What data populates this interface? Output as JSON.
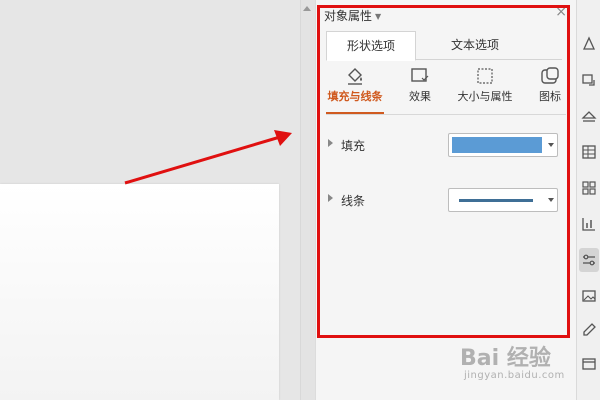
{
  "panel": {
    "title": "对象属性",
    "close_symbol": "×",
    "tabs": [
      {
        "label": "形状选项",
        "active": true
      },
      {
        "label": "文本选项",
        "active": false
      }
    ],
    "subtabs": [
      {
        "label": "填充与线条",
        "icon": "fill-bucket-icon",
        "active": true
      },
      {
        "label": "效果",
        "icon": "effects-icon",
        "active": false
      },
      {
        "label": "大小与属性",
        "icon": "size-properties-icon",
        "active": false
      },
      {
        "label": "图标",
        "icon": "picture-icon",
        "active": false
      }
    ],
    "sections": [
      {
        "label": "填充",
        "value_color": "#5b9bd5"
      },
      {
        "label": "线条",
        "value_color": "#3f6f96"
      }
    ]
  },
  "toolbar": {
    "icons": [
      "shape-icon",
      "transition-icon",
      "layers-icon",
      "table-icon",
      "grid-icon",
      "chart-icon",
      "settings-sliders-icon",
      "image-icon",
      "edit-icon",
      "window-icon"
    ],
    "active_index": 6
  },
  "watermark": {
    "main": "Bai  经验",
    "sub": "jingyan.baidu.com"
  },
  "colors": {
    "accent": "#d05a1f",
    "annotation_red": "#e01010"
  }
}
